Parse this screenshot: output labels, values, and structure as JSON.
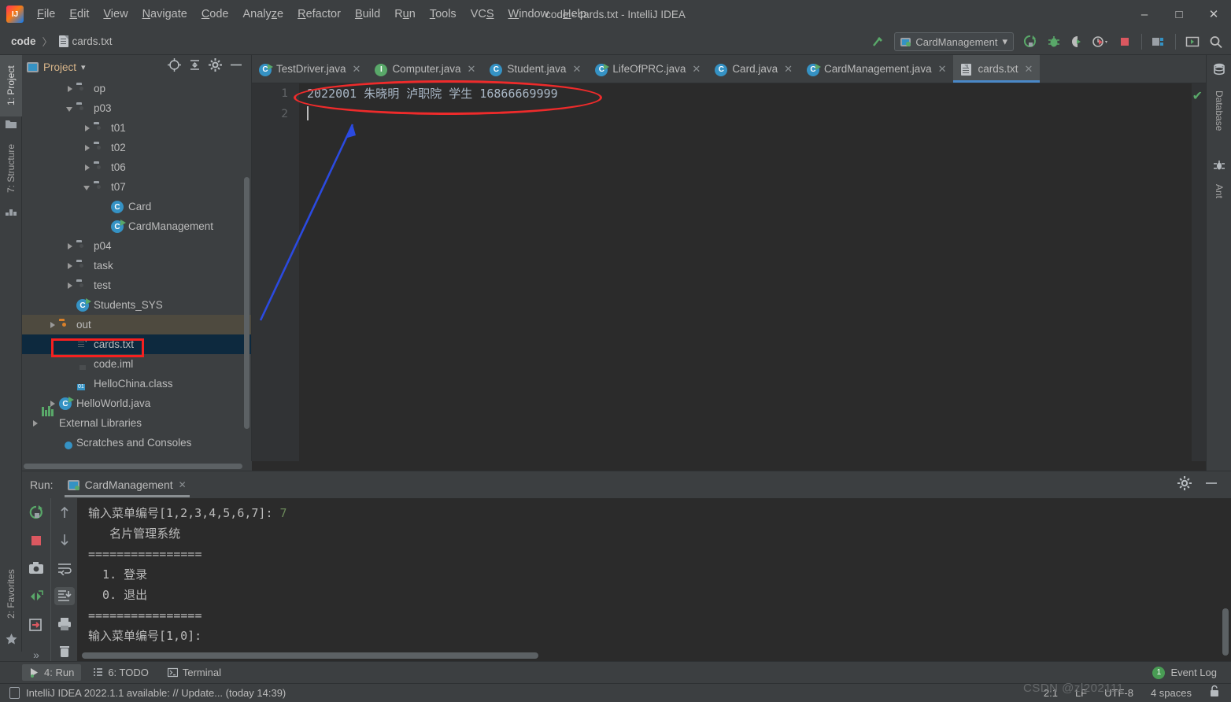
{
  "window": {
    "title": "code - cards.txt - IntelliJ IDEA",
    "minimize": "–",
    "maximize": "□",
    "close": "✕"
  },
  "menu": {
    "items": [
      {
        "label": "File",
        "mnemonic": "F"
      },
      {
        "label": "Edit",
        "mnemonic": "E"
      },
      {
        "label": "View",
        "mnemonic": "V"
      },
      {
        "label": "Navigate",
        "mnemonic": "N"
      },
      {
        "label": "Code",
        "mnemonic": "C"
      },
      {
        "label": "Analyze",
        "mnemonic": "z"
      },
      {
        "label": "Refactor",
        "mnemonic": "R"
      },
      {
        "label": "Build",
        "mnemonic": "B"
      },
      {
        "label": "Run",
        "mnemonic": "u"
      },
      {
        "label": "Tools",
        "mnemonic": "T"
      },
      {
        "label": "VCS",
        "mnemonic": "S"
      },
      {
        "label": "Window",
        "mnemonic": "W"
      },
      {
        "label": "Help",
        "mnemonic": "H"
      }
    ]
  },
  "navbar": {
    "breadcrumb_project": "code",
    "breadcrumb_separator": "〉",
    "breadcrumb_file": "cards.txt",
    "run_configuration": "CardManagement",
    "run_config_caret": "▾",
    "icons": [
      "build-hammer-icon",
      "run-icon",
      "debug-icon",
      "run-with-coverage-icon",
      "profiler-icon",
      "stop-icon",
      "project-structure-icon",
      "terminal-icon",
      "search-everywhere-icon"
    ]
  },
  "left_stripe": {
    "tabs": [
      {
        "label": "1: Project",
        "icon": "project-icon",
        "active": true
      },
      {
        "label": "7: Structure",
        "icon": "structure-icon",
        "active": false
      }
    ],
    "bottom_tabs": [
      {
        "label": "2: Favorites",
        "icon": "star-icon",
        "active": false
      }
    ]
  },
  "right_stripe": {
    "tabs": [
      {
        "label": "Database",
        "icon": "database-icon"
      },
      {
        "label": "Ant",
        "icon": "ant-icon"
      }
    ]
  },
  "project_panel": {
    "title": "Project",
    "caret": "▾",
    "actions": [
      "locate-icon",
      "collapse-all-icon",
      "settings-gear-icon",
      "hide-icon"
    ],
    "tree": [
      {
        "label": "op",
        "indent": 2,
        "arrow": "right",
        "icon": "folder"
      },
      {
        "label": "p03",
        "indent": 2,
        "arrow": "down",
        "icon": "folder"
      },
      {
        "label": "t01",
        "indent": 3,
        "arrow": "right",
        "icon": "folder"
      },
      {
        "label": "t02",
        "indent": 3,
        "arrow": "right",
        "icon": "folder"
      },
      {
        "label": "t06",
        "indent": 3,
        "arrow": "right",
        "icon": "folder"
      },
      {
        "label": "t07",
        "indent": 3,
        "arrow": "down",
        "icon": "folder"
      },
      {
        "label": "Card",
        "indent": 4,
        "arrow": "none",
        "icon": "class"
      },
      {
        "label": "CardManagement",
        "indent": 4,
        "arrow": "none",
        "icon": "class-runnable"
      },
      {
        "label": "p04",
        "indent": 2,
        "arrow": "right",
        "icon": "folder"
      },
      {
        "label": "task",
        "indent": 2,
        "arrow": "right",
        "icon": "folder"
      },
      {
        "label": "test",
        "indent": 2,
        "arrow": "right",
        "icon": "folder"
      },
      {
        "label": "Students_SYS",
        "indent": 2,
        "arrow": "none",
        "icon": "class-runnable"
      },
      {
        "label": "out",
        "indent": 1,
        "arrow": "right",
        "icon": "folder-orange",
        "state": "highlight"
      },
      {
        "label": "cards.txt",
        "indent": 2,
        "arrow": "none",
        "icon": "txt",
        "state": "selected"
      },
      {
        "label": "code.iml",
        "indent": 2,
        "arrow": "none",
        "icon": "iml"
      },
      {
        "label": "HelloChina.class",
        "indent": 2,
        "arrow": "none",
        "icon": "classfile"
      },
      {
        "label": "HelloWorld.java",
        "indent": 1,
        "arrow": "right",
        "icon": "class-runnable"
      },
      {
        "label": "External Libraries",
        "indent": 0,
        "arrow": "right",
        "icon": "libraries"
      },
      {
        "label": "Scratches and Consoles",
        "indent": 1,
        "arrow": "none",
        "icon": "scratches"
      }
    ]
  },
  "editor_tabs": [
    {
      "label": "TestDriver.java",
      "icon": "java-class-runnable-icon",
      "active": false,
      "close": "✕"
    },
    {
      "label": "Computer.java",
      "icon": "java-interface-icon",
      "active": false,
      "close": "✕"
    },
    {
      "label": "Student.java",
      "icon": "java-class-icon",
      "active": false,
      "close": "✕"
    },
    {
      "label": "LifeOfPRC.java",
      "icon": "java-class-runnable-icon",
      "active": false,
      "close": "✕"
    },
    {
      "label": "Card.java",
      "icon": "java-class-icon",
      "active": false,
      "close": "✕"
    },
    {
      "label": "CardManagement.java",
      "icon": "java-class-runnable-icon",
      "active": false,
      "close": "✕"
    },
    {
      "label": "cards.txt",
      "icon": "text-file-icon",
      "active": true,
      "close": "✕"
    }
  ],
  "editor": {
    "line_numbers": [
      "1",
      "2"
    ],
    "lines": [
      "2022001 朱晓明 泸职院 学生 16866669999",
      ""
    ],
    "inspection_status": "✔"
  },
  "run_tool_window": {
    "label": "Run:",
    "tab_label": "CardManagement",
    "tab_close": "✕",
    "header_actions": [
      "settings-gear-icon",
      "hide-icon"
    ],
    "left_actions": [
      "rerun-icon",
      "stop-icon",
      "screenshot-icon",
      "toggle-tasks-icon",
      "export-icon",
      "more-icon"
    ],
    "right_actions": [
      "up-arrow-icon",
      "down-arrow-icon",
      "soft-wrap-icon",
      "scroll-to-end-icon",
      "print-icon",
      "clear-all-icon"
    ],
    "console_lines": [
      {
        "text": "输入菜单编号[1,2,3,4,5,6,7]: ",
        "suffix": "7"
      },
      {
        "text": "   名片管理系统",
        "suffix": ""
      },
      {
        "text": "================",
        "suffix": ""
      },
      {
        "text": "  1. 登录",
        "suffix": ""
      },
      {
        "text": "  0. 退出",
        "suffix": ""
      },
      {
        "text": "================",
        "suffix": ""
      },
      {
        "text": "输入菜单编号[1,0]:",
        "suffix": ""
      }
    ]
  },
  "bottom_stripe": {
    "tabs": [
      {
        "label": "4: Run",
        "icon": "run-icon",
        "active": true
      },
      {
        "label": "6: TODO",
        "icon": "todo-icon",
        "active": false
      },
      {
        "label": "Terminal",
        "icon": "terminal-icon",
        "active": false
      }
    ],
    "event_log": {
      "label": "Event Log",
      "count": "1"
    }
  },
  "statusbar": {
    "message": "IntelliJ IDEA 2022.1.1 available: // Update... (today 14:39)",
    "caret_position": "2:1",
    "line_separator": "LF",
    "encoding": "UTF-8",
    "indent": "4 spaces",
    "lock_icon": "unlocked-icon"
  },
  "watermark": "CSDN @zl202111",
  "annotations": {
    "ellipse_color": "#ee2b2b",
    "rect_color": "#f52020",
    "arrow_color": "#2b4ae0"
  }
}
